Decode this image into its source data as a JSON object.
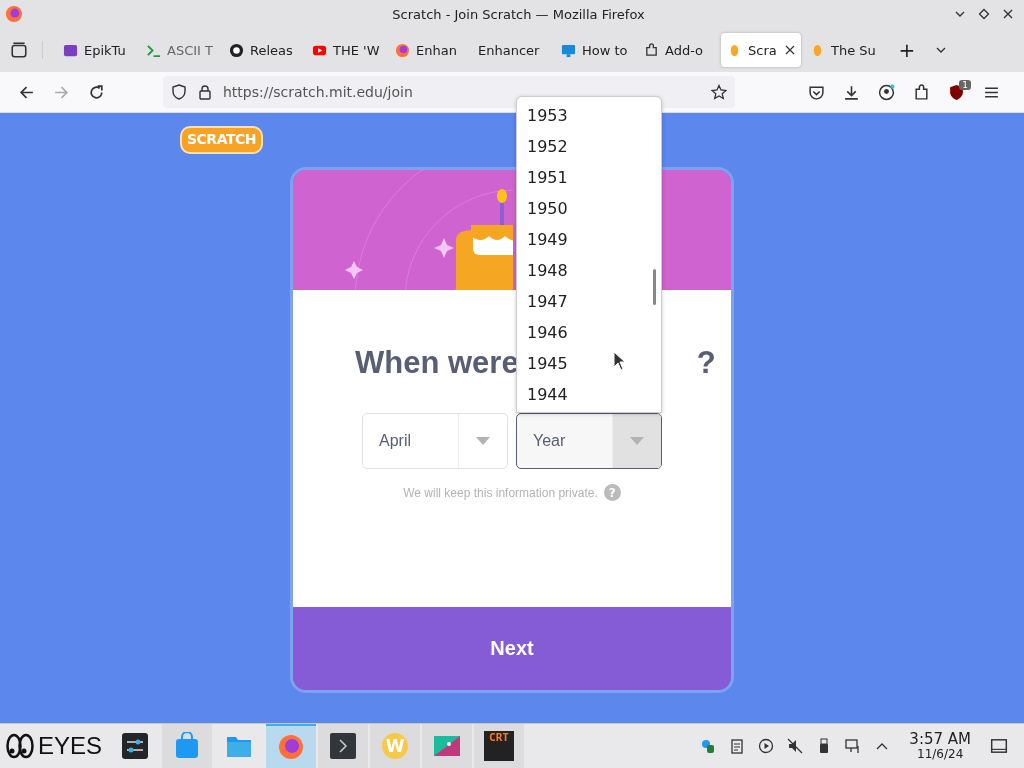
{
  "window": {
    "title": "Scratch - Join Scratch — Mozilla Firefox"
  },
  "tabs": [
    {
      "kind": "epik",
      "label": "EpikTu",
      "selected": false
    },
    {
      "kind": "terminal",
      "label": "ASCII T",
      "selected": false
    },
    {
      "kind": "github",
      "label": "Releas",
      "selected": false
    },
    {
      "kind": "youtube",
      "label": "THE 'W",
      "selected": false
    },
    {
      "kind": "firefox",
      "label": "Enhan",
      "selected": false
    },
    {
      "kind": "none",
      "label": "Enhancer",
      "selected": false
    },
    {
      "kind": "monitor",
      "label": "How to",
      "selected": false
    },
    {
      "kind": "puzzle",
      "label": "Add-o",
      "selected": false
    },
    {
      "kind": "scratch",
      "label": "Scra",
      "selected": true
    },
    {
      "kind": "scratch",
      "label": "The Su",
      "selected": false
    }
  ],
  "new_tab": "+",
  "address_bar": {
    "url": "https://scratch.mit.edu/join"
  },
  "extension_badge": "1",
  "page": {
    "logo": "SCRATCH",
    "heading": "When were",
    "heading_end": "?",
    "month_select": {
      "value": "April"
    },
    "year_select": {
      "placeholder": "Year",
      "open": true
    },
    "year_options": [
      "1953",
      "1952",
      "1951",
      "1950",
      "1949",
      "1948",
      "1947",
      "1946",
      "1945",
      "1944"
    ],
    "privacy_note": "We will keep this information private.",
    "help_icon": "?",
    "next_button": "Next"
  },
  "taskbar": {
    "launcher": "EYES",
    "apps": [
      {
        "kind": "settings",
        "selected": false,
        "running": false
      },
      {
        "kind": "store",
        "selected": false,
        "running": true
      },
      {
        "kind": "folder",
        "selected": false,
        "running": false
      },
      {
        "kind": "firefox",
        "selected": true,
        "running": true
      },
      {
        "kind": "terminal",
        "selected": false,
        "running": true
      },
      {
        "kind": "letter",
        "label": "W",
        "selected": false,
        "running": true
      },
      {
        "kind": "drawing",
        "selected": false,
        "running": true
      },
      {
        "kind": "crt",
        "label": "CRT",
        "selected": false,
        "running": true
      }
    ],
    "time": "3:57 AM",
    "date": "11/6/24"
  }
}
